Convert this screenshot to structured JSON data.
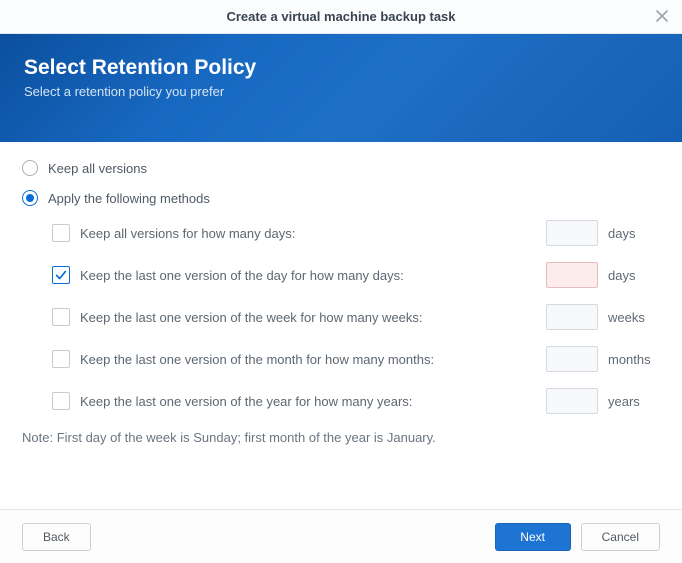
{
  "window": {
    "title": "Create a virtual machine backup task"
  },
  "banner": {
    "title": "Select Retention Policy",
    "subtitle": "Select a retention policy you prefer"
  },
  "radios": {
    "keep_all": "Keep all versions",
    "apply_methods": "Apply the following methods"
  },
  "methods": [
    {
      "label": "Keep all versions for how many days:",
      "unit": "days",
      "checked": false,
      "error": false,
      "value": ""
    },
    {
      "label": "Keep the last one version of the day for how many days:",
      "unit": "days",
      "checked": true,
      "error": true,
      "value": ""
    },
    {
      "label": "Keep the last one version of the week for how many weeks:",
      "unit": "weeks",
      "checked": false,
      "error": false,
      "value": ""
    },
    {
      "label": "Keep the last one version of the month for how many months:",
      "unit": "months",
      "checked": false,
      "error": false,
      "value": ""
    },
    {
      "label": "Keep the last one version of the year for how many years:",
      "unit": "years",
      "checked": false,
      "error": false,
      "value": ""
    }
  ],
  "note": {
    "prefix": "Note:",
    "text": " First day of the week is Sunday; first month of the year is January."
  },
  "footer": {
    "back": "Back",
    "next": "Next",
    "cancel": "Cancel"
  }
}
